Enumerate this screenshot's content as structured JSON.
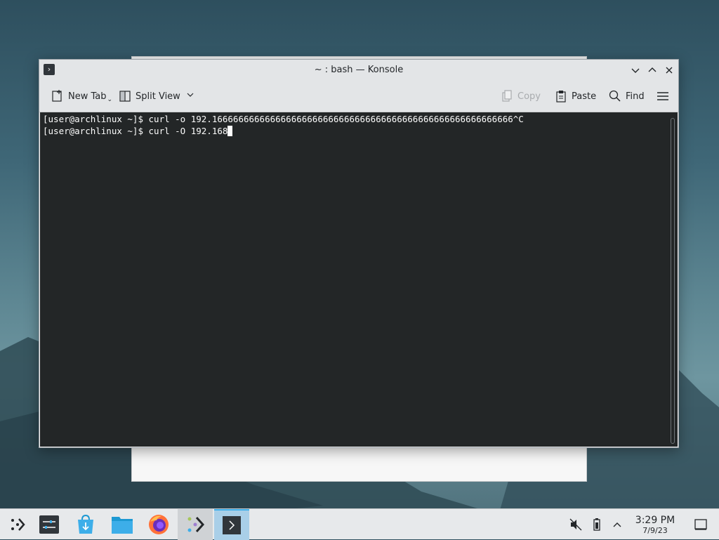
{
  "window": {
    "title": "~ : bash — Konsole"
  },
  "toolbar": {
    "new_tab": "New Tab",
    "split_view": "Split View",
    "copy": "Copy",
    "paste": "Paste",
    "find": "Find"
  },
  "terminal": {
    "line1": "[user@archlinux ~]$ curl -o 192.166666666666666666666666666666666666666666666666666666666^C",
    "line2": "[user@archlinux ~]$ curl -O 192.168"
  },
  "taskbar": {
    "apps": [
      "application-launcher-icon",
      "system-settings-icon",
      "discover-store-icon",
      "file-manager-icon",
      "firefox-icon",
      "kde-connect-icon",
      "konsole-icon"
    ]
  },
  "clock": {
    "time": "3:29 PM",
    "date": "7/9/23"
  },
  "colors": {
    "accent": "#3daee9",
    "terminal_bg": "#232627",
    "window_bg": "#eff0f1"
  }
}
